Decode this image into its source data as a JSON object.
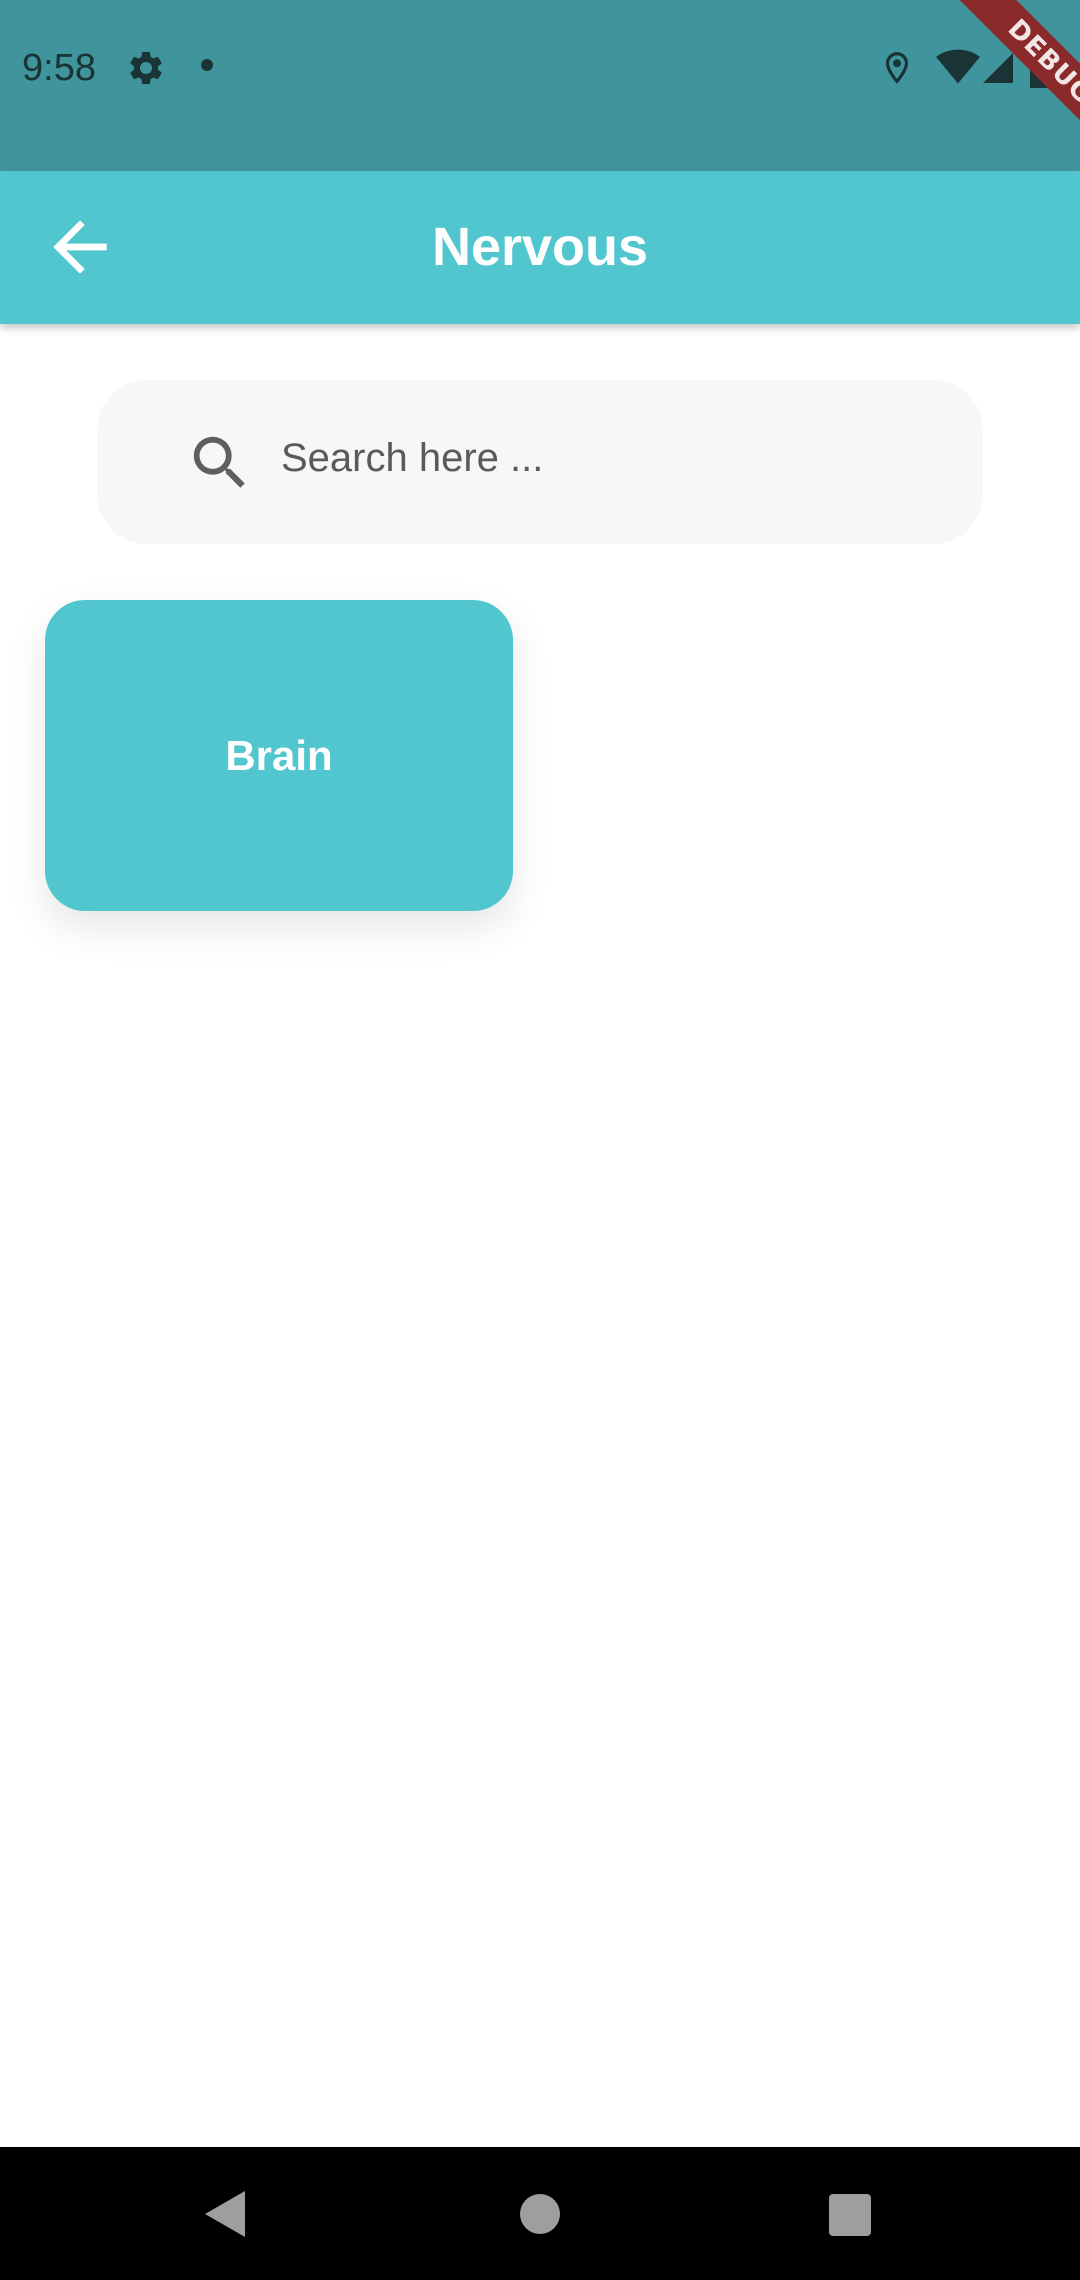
{
  "status_bar": {
    "time": "9:58",
    "background": "#40959c",
    "icons": [
      "gear-icon",
      "notification-dot-icon",
      "location-icon",
      "wifi-icon",
      "signal-icon",
      "battery-icon"
    ],
    "debug_banner": "DEBUG"
  },
  "app_bar": {
    "title": "Nervous",
    "background": "#52c6cf",
    "back_icon": "arrow-back-icon"
  },
  "search": {
    "placeholder": "Search here ...",
    "value": "",
    "icon": "search-icon"
  },
  "categories": [
    {
      "label": "Brain",
      "color": "#52c6cf"
    }
  ],
  "nav_bar": {
    "buttons": [
      "back-triangle-icon",
      "home-circle-icon",
      "recents-square-icon"
    ]
  }
}
